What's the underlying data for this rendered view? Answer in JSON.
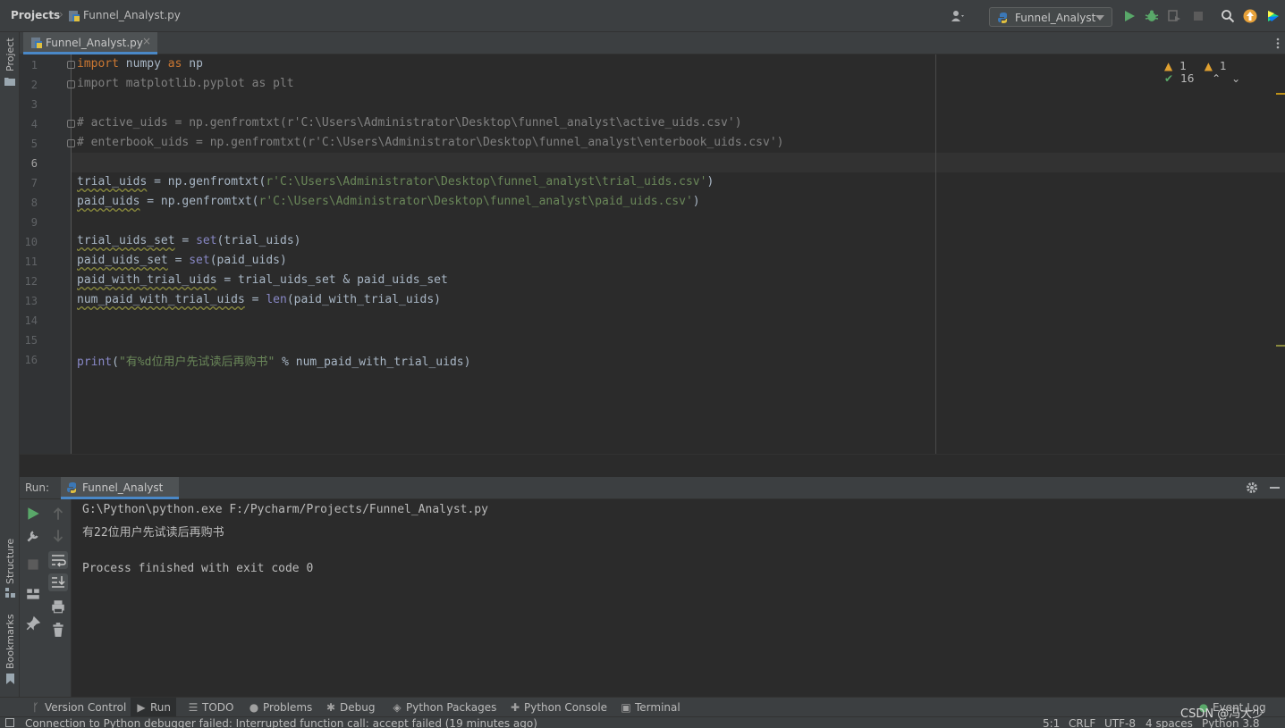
{
  "navbar": {
    "project_label": "Projects",
    "file_label": "Funnel_Analyst.py",
    "run_config": "Funnel_Analyst"
  },
  "left_stripe": {
    "project": "Project",
    "structure": "Structure",
    "bookmarks": "Bookmarks"
  },
  "editor": {
    "tab_label": "Funnel_Analyst.py",
    "inspections": {
      "warnings": "1",
      "weak_warnings": "1",
      "typos": "16"
    },
    "line_numbers": [
      "1",
      "2",
      "3",
      "4",
      "5",
      "6",
      "7",
      "8",
      "9",
      "10",
      "11",
      "12",
      "13",
      "14",
      "15",
      "16"
    ],
    "code": {
      "l1_kw": "import",
      "l1_mod": " numpy ",
      "l1_as": "as",
      "l1_alias": " np",
      "l2": "import matplotlib.pyplot as plt",
      "l4": "# active_uids = np.genfromtxt(r'C:\\Users\\Administrator\\Desktop\\funnel_analyst\\active_uids.csv')",
      "l5": "# enterbook_uids = np.genfromtxt(r'C:\\Users\\Administrator\\Desktop\\funnel_analyst\\enterbook_uids.csv')",
      "l7_var": "trial_uids",
      "l7_eq": " = np.genfromtxt(",
      "l7_str": "r'C:\\Users\\Administrator\\Desktop\\funnel_analyst\\trial_uids.csv'",
      "l7_end": ")",
      "l8_var": "paid_uids",
      "l8_eq": " = np.genfromtxt(",
      "l8_str": "r'C:\\Users\\Administrator\\Desktop\\funnel_analyst\\paid_uids.csv'",
      "l8_end": ")",
      "l10_var": "trial_uids_set",
      "l10_eq": " = ",
      "l10_fn": "set",
      "l10_args": "(trial_uids)",
      "l11_var": "paid_uids_set",
      "l11_eq": " = ",
      "l11_fn": "set",
      "l11_args": "(paid_uids)",
      "l12_var": "paid_with_trial_uids",
      "l12_rest": " = trial_uids_set & paid_uids_set",
      "l13_var": "num_paid_with_trial_uids",
      "l13_eq": " = ",
      "l13_fn": "len",
      "l13_args": "(paid_with_trial_uids)",
      "l16_fn": "print",
      "l16_open": "(",
      "l16_str": "\"有%d位用户先试读后再购书\"",
      "l16_rest": " % num_paid_with_trial_uids)"
    }
  },
  "run": {
    "title": "Run:",
    "tab_label": "Funnel_Analyst",
    "console": [
      "G:\\Python\\python.exe F:/Pycharm/Projects/Funnel_Analyst.py",
      "有22位用户先试读后再购书",
      "",
      "Process finished with exit code 0"
    ]
  },
  "tool_tabs": {
    "version_control": "Version Control",
    "run": "Run",
    "todo": "TODO",
    "problems": "Problems",
    "debug": "Debug",
    "python_packages": "Python Packages",
    "python_console": "Python Console",
    "terminal": "Terminal",
    "event_log": "Event Log"
  },
  "status": {
    "message": "Connection to Python debugger failed: Interrupted function call: accept failed (19 minutes ago)",
    "position": "5:1",
    "line_sep": "CRLF",
    "encoding": "UTF-8",
    "indent": "4 spaces",
    "interpreter": "Python 3.8"
  },
  "watermark": "CSDN @冯大少",
  "colors": {
    "keyword": "#cc7832",
    "builtin": "#8888c6",
    "string": "#6a8759",
    "comment": "#808080",
    "run_green": "#59a869",
    "accent": "#4a88c7"
  }
}
